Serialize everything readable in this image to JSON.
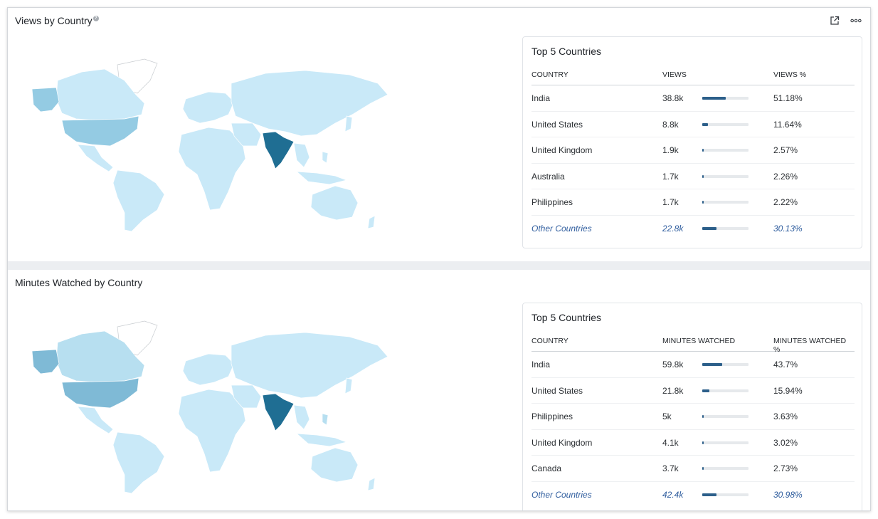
{
  "panels": [
    {
      "title": "Views by Country",
      "help_icon": "help-icon",
      "card": {
        "title": "Top 5 Countries",
        "headers": [
          "COUNTRY",
          "VIEWS",
          "VIEWS %"
        ],
        "rows": [
          {
            "country": "India",
            "value": "38.8k",
            "pct": "51.18%",
            "fraction": 0.5118
          },
          {
            "country": "United States",
            "value": "8.8k",
            "pct": "11.64%",
            "fraction": 0.1164
          },
          {
            "country": "United Kingdom",
            "value": "1.9k",
            "pct": "2.57%",
            "fraction": 0.0257
          },
          {
            "country": "Australia",
            "value": "1.7k",
            "pct": "2.26%",
            "fraction": 0.0226
          },
          {
            "country": "Philippines",
            "value": "1.7k",
            "pct": "2.22%",
            "fraction": 0.0222
          },
          {
            "country": "Other Countries",
            "value": "22.8k",
            "pct": "30.13%",
            "fraction": 0.3013,
            "other": true
          }
        ]
      }
    },
    {
      "title": "Minutes Watched by Country",
      "card": {
        "title": "Top 5 Countries",
        "headers": [
          "COUNTRY",
          "MINUTES WATCHED",
          "MINUTES WATCHED %"
        ],
        "rows": [
          {
            "country": "India",
            "value": "59.8k",
            "pct": "43.7%",
            "fraction": 0.437
          },
          {
            "country": "United States",
            "value": "21.8k",
            "pct": "15.94%",
            "fraction": 0.1594
          },
          {
            "country": "Philippines",
            "value": "5k",
            "pct": "3.63%",
            "fraction": 0.0363
          },
          {
            "country": "United Kingdom",
            "value": "4.1k",
            "pct": "3.02%",
            "fraction": 0.0302
          },
          {
            "country": "Canada",
            "value": "3.7k",
            "pct": "2.73%",
            "fraction": 0.0273
          },
          {
            "country": "Other Countries",
            "value": "42.4k",
            "pct": "30.98%",
            "fraction": 0.3098,
            "other": true
          }
        ]
      }
    }
  ],
  "actions": {
    "open_icon": "open-external-icon",
    "more_icon": "more-options-icon"
  },
  "colors": {
    "bar_fill": "#2c5f8a",
    "map_light": "#c9e9f8",
    "map_mid": "#94cbe3",
    "map_dark": "#1f6e93",
    "link": "#2f5d9e"
  }
}
